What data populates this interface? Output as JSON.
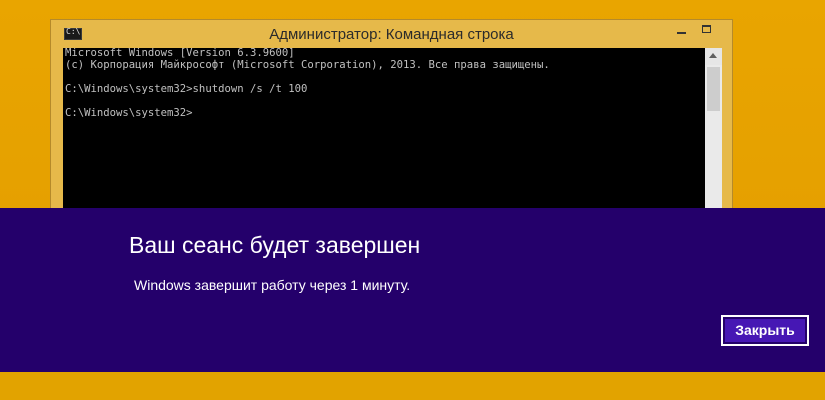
{
  "colors": {
    "desktop": "#e8a400",
    "dialog_background": "#24006b",
    "dialog_button": "#4617b4",
    "console_text": "#c0c0c0"
  },
  "cmd_window": {
    "icon_label": "C:\\",
    "title": "Администратор: Командная строка",
    "console_lines": [
      "Microsoft Windows [Version 6.3.9600]",
      "(c) Корпорация Майкрософт (Microsoft Corporation), 2013. Все права защищены.",
      "",
      "C:\\Windows\\system32>shutdown /s /t 100",
      "",
      "C:\\Windows\\system32>"
    ]
  },
  "dialog": {
    "title": "Ваш сеанс будет завершен",
    "message": "Windows завершит работу через 1 минуту.",
    "close_label": "Закрыть"
  }
}
